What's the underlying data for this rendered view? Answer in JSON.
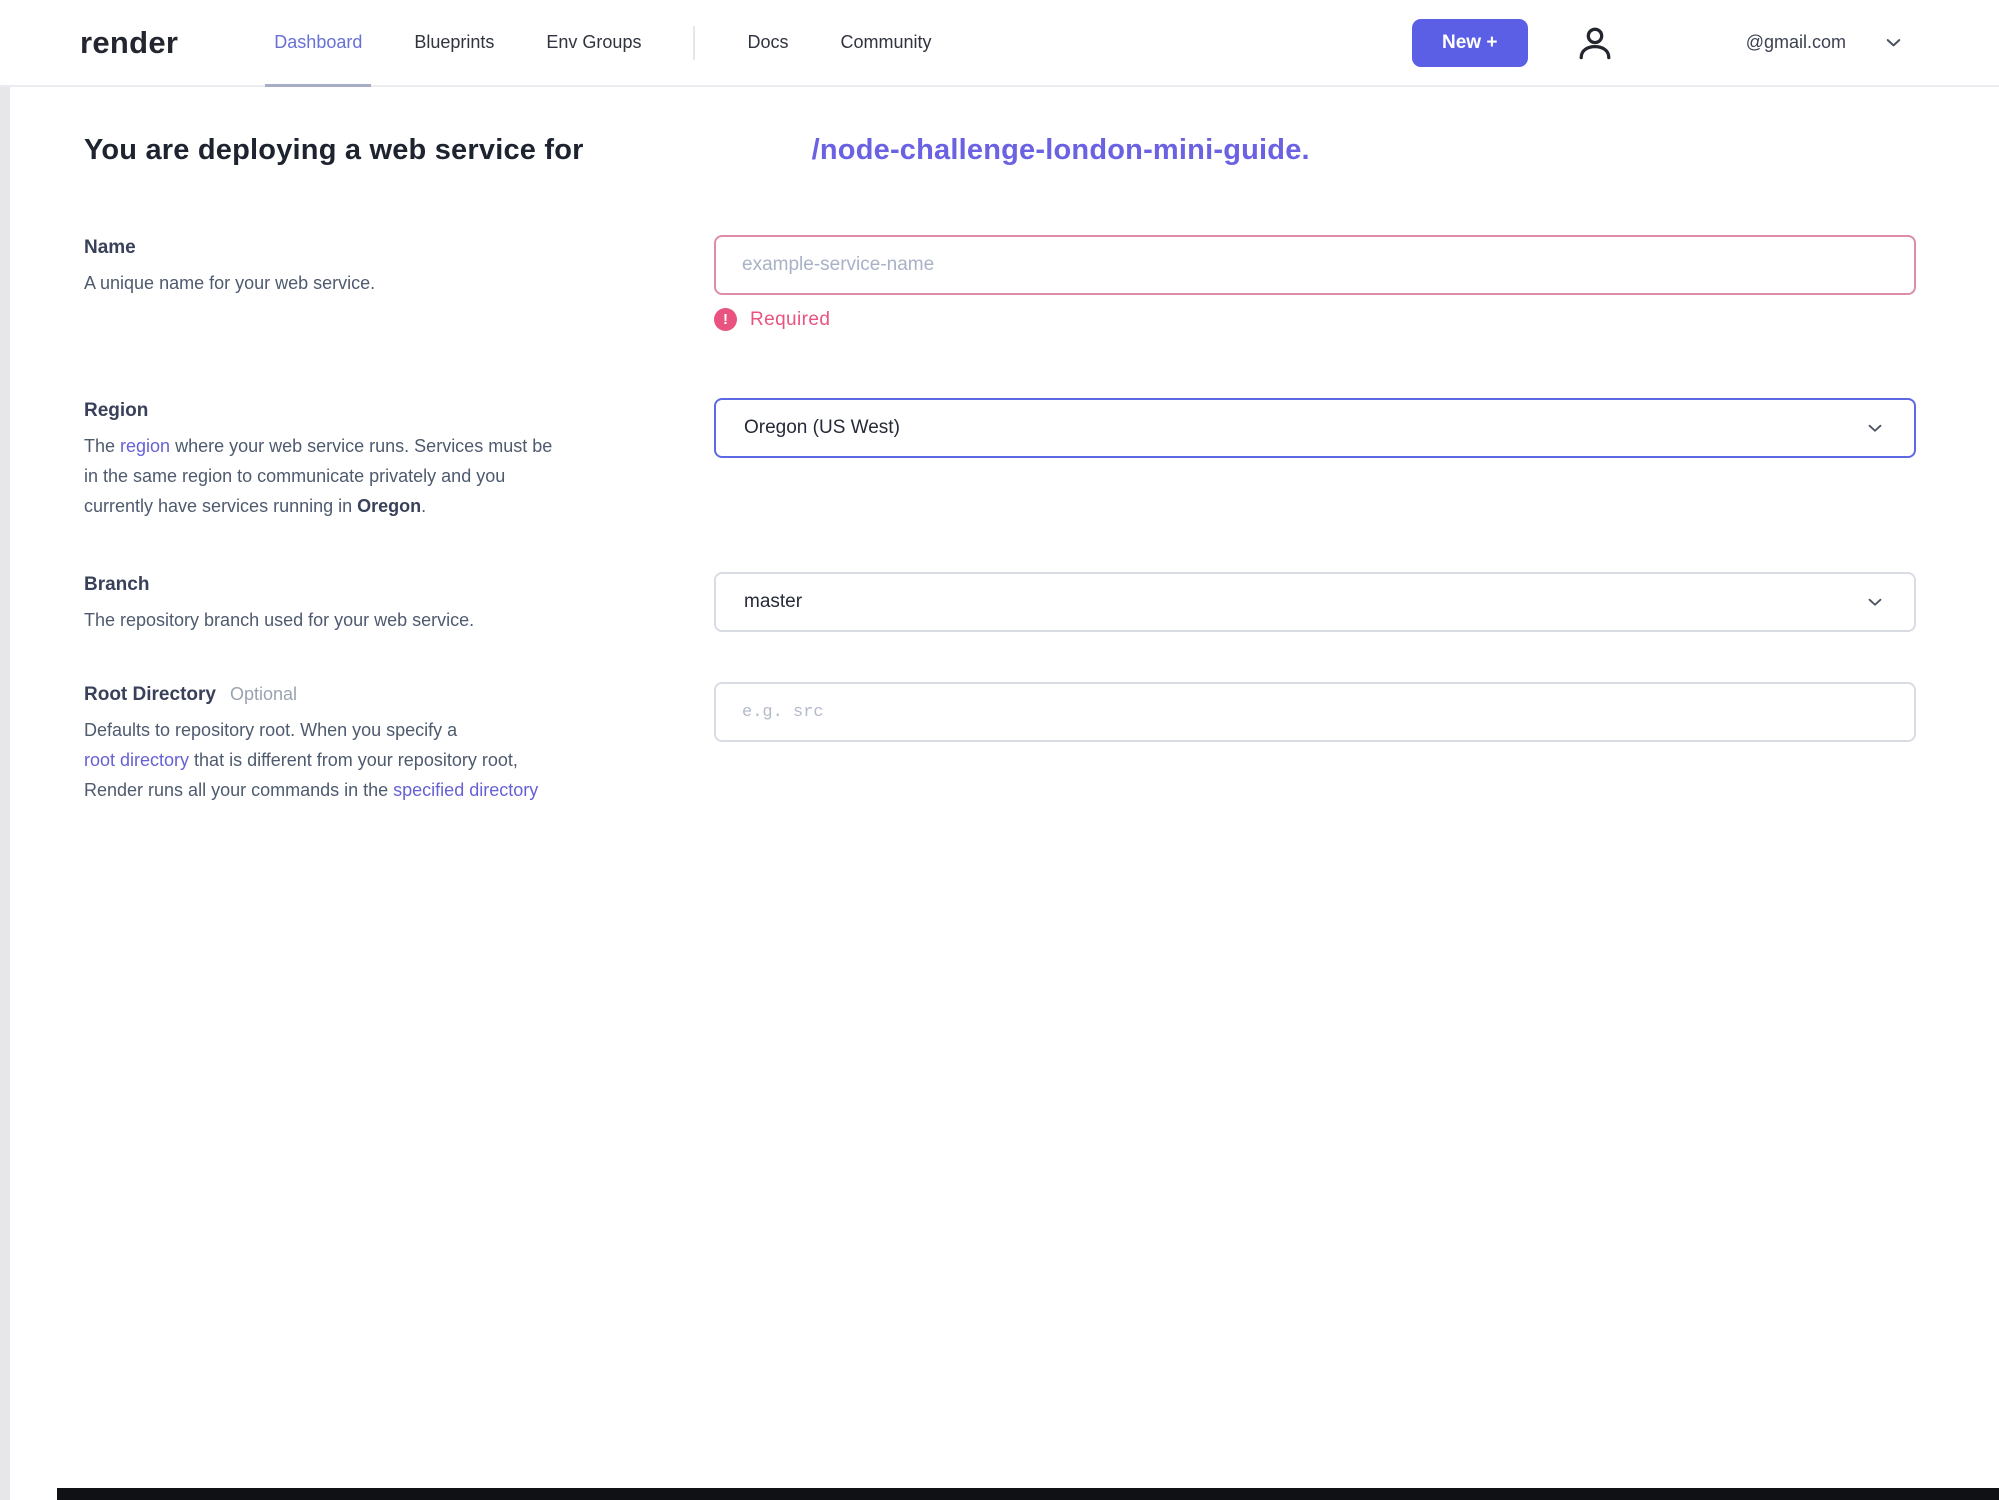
{
  "nav": {
    "logo": "render",
    "items": [
      {
        "label": "Dashboard",
        "active": true
      },
      {
        "label": "Blueprints",
        "active": false
      },
      {
        "label": "Env Groups",
        "active": false
      },
      {
        "label": "Docs",
        "active": false
      },
      {
        "label": "Community",
        "active": false
      }
    ],
    "new_button_label": "New +",
    "account_email": "@gmail.com"
  },
  "heading": {
    "prefix": "You are deploying a web service for",
    "repo_link": "/node-challenge-london-mini-guide."
  },
  "form": {
    "name": {
      "label": "Name",
      "description": "A unique name for your web service.",
      "placeholder": "example-service-name",
      "error_icon": "!",
      "error_text": "Required"
    },
    "region": {
      "label": "Region",
      "value": "Oregon (US West)",
      "description_lines": [
        [
          {
            "text": "The ",
            "kind": "text"
          },
          {
            "text": "region",
            "kind": "link"
          },
          {
            "text": " where your web service runs. Services must be",
            "kind": "text"
          }
        ],
        [
          {
            "text": "in the same region to communicate privately and you",
            "kind": "text"
          }
        ],
        [
          {
            "text": "currently have services running in ",
            "kind": "text"
          },
          {
            "text": "Oregon",
            "kind": "bold"
          },
          {
            "text": ".",
            "kind": "text"
          }
        ]
      ]
    },
    "branch": {
      "label": "Branch",
      "description": "The repository branch used for your web service.",
      "value": "master"
    },
    "root_directory": {
      "label": "Root Directory",
      "optional_tag": "Optional",
      "placeholder": "e.g. src",
      "description_lines": [
        [
          {
            "text": "Defaults to repository root. When you specify a",
            "kind": "text"
          }
        ],
        [
          {
            "text": "root directory",
            "kind": "link"
          },
          {
            "text": " that is different from your repository root,",
            "kind": "text"
          }
        ],
        [
          {
            "text": "Render runs all your commands in the ",
            "kind": "text"
          },
          {
            "text": "specified directory",
            "kind": "link"
          }
        ]
      ]
    }
  },
  "colors": {
    "accent_purple": "#5a5fe6",
    "nav_active_purple": "#6770d6",
    "repo_link_purple": "#6b62e3",
    "inline_link_purple": "#6661d6",
    "error_pink": "#e8537f",
    "error_border_pink": "#de8da6",
    "focused_border_purple": "#5c69e2",
    "default_border_gray": "#dadce4"
  }
}
